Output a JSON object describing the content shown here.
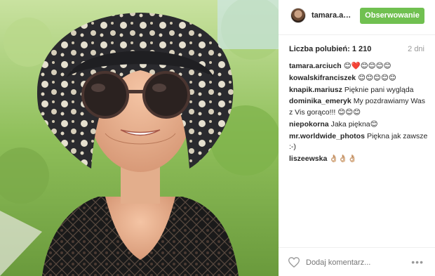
{
  "post": {
    "image_alt": "Kobieta w kapeluszu i okularach przeciwsłonecznych"
  },
  "header": {
    "username": "tamara.arc...",
    "follow_label": "Obserwowanie",
    "follow_color": "#70c050"
  },
  "stats": {
    "likes": "Liczba polubień: 1 210",
    "time": "2 dni"
  },
  "comments": [
    {
      "user": "tamara.arciuch",
      "text": "😊❤️😊😊😊😊"
    },
    {
      "user": "kowalskifranciszek",
      "text": "😊😊😊😊😊"
    },
    {
      "user": "knapik.mariusz",
      "text": "Pięknie pani wygląda"
    },
    {
      "user": "dominika_emeryk",
      "text": "My pozdrawiamy Was z Vis gorąco!!! 😊😊😊"
    },
    {
      "user": "niepokorna",
      "text": "Jaka piękna😊"
    },
    {
      "user": "mr.worldwide_photos",
      "text": "Piękna jak zawsze :-)"
    },
    {
      "user": "liszeewska",
      "text": "👌🏼👌🏼👌🏼"
    }
  ],
  "footer": {
    "comment_placeholder": "Dodaj komentarz...",
    "more_label": "•••"
  },
  "icons": {
    "like": "heart-icon",
    "more": "more-options-icon"
  }
}
